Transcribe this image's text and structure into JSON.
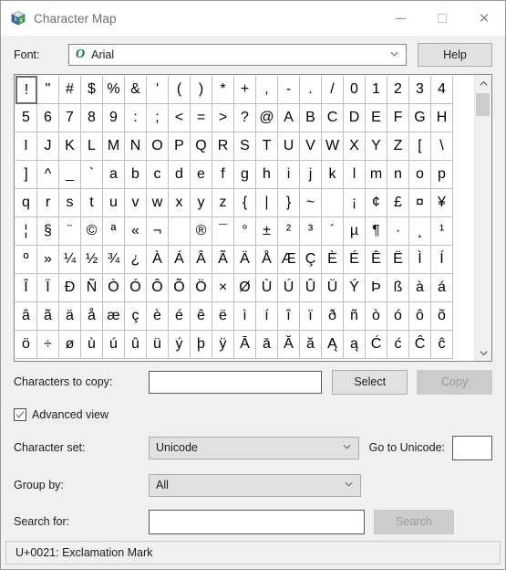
{
  "window": {
    "title": "Character Map",
    "icon": "character-map-icon",
    "controls": {
      "minimize": "minimize-icon",
      "maximize": "maximize-icon",
      "close": "close-icon"
    }
  },
  "font_row": {
    "label": "Font:",
    "font_icon": "O",
    "font_value": "Arial",
    "help_label": "Help"
  },
  "grid": {
    "columns": 20,
    "selected_index": 0,
    "characters": [
      "!",
      "\"",
      "#",
      "$",
      "%",
      "&",
      "'",
      "(",
      ")",
      "*",
      "+",
      ",",
      "-",
      ".",
      "/",
      "0",
      "1",
      "2",
      "3",
      "4",
      "5",
      "6",
      "7",
      "8",
      "9",
      ":",
      ";",
      "<",
      "=",
      ">",
      "?",
      "@",
      "A",
      "B",
      "C",
      "D",
      "E",
      "F",
      "G",
      "H",
      "I",
      "J",
      "K",
      "L",
      "M",
      "N",
      "O",
      "P",
      "Q",
      "R",
      "S",
      "T",
      "U",
      "V",
      "W",
      "X",
      "Y",
      "Z",
      "[",
      "\\",
      "]",
      "^",
      "_",
      "`",
      "a",
      "b",
      "c",
      "d",
      "e",
      "f",
      "g",
      "h",
      "i",
      "j",
      "k",
      "l",
      "m",
      "n",
      "o",
      "p",
      "q",
      "r",
      "s",
      "t",
      "u",
      "v",
      "w",
      "x",
      "y",
      "z",
      "{",
      "|",
      "}",
      "~",
      " ",
      "¡",
      "¢",
      "£",
      "¤",
      "¥",
      "¦",
      "§",
      "¨",
      "©",
      "ª",
      "«",
      "¬",
      "­",
      "®",
      "¯",
      "°",
      "±",
      "²",
      "³",
      "´",
      "µ",
      "¶",
      "·",
      "¸",
      "¹",
      "º",
      "»",
      "¼",
      "½",
      "¾",
      "¿",
      "À",
      "Á",
      "Â",
      "Ã",
      "Ä",
      "Å",
      "Æ",
      "Ç",
      "È",
      "É",
      "Ê",
      "Ë",
      "Ì",
      "Í",
      "Î",
      "Ï",
      "Ð",
      "Ñ",
      "Ò",
      "Ó",
      "Ô",
      "Õ",
      "Ö",
      "×",
      "Ø",
      "Ù",
      "Ú",
      "Û",
      "Ü",
      "Ý",
      "Þ",
      "ß",
      "à",
      "á",
      "â",
      "ã",
      "ä",
      "å",
      "æ",
      "ç",
      "è",
      "é",
      "ê",
      "ë",
      "ì",
      "í",
      "î",
      "ï",
      "ð",
      "ñ",
      "ò",
      "ó",
      "ô",
      "õ",
      "ö",
      "÷",
      "ø",
      "ù",
      "ú",
      "û",
      "ü",
      "ý",
      "þ",
      "ÿ",
      "Ā",
      "ā",
      "Ă",
      "ă",
      "Ą",
      "ą",
      "Ć",
      "ć",
      "Ĉ",
      "ĉ"
    ],
    "scrollbar": {
      "up_icon": "chevron-up-icon",
      "down_icon": "chevron-down-icon"
    }
  },
  "copy_row": {
    "label": "Characters to copy:",
    "value": "",
    "placeholder": "",
    "select_label": "Select",
    "copy_label": "Copy",
    "copy_disabled": true
  },
  "advanced_view": {
    "label": "Advanced view",
    "checked": true
  },
  "character_set": {
    "label": "Character set:",
    "value": "Unicode"
  },
  "go_to_unicode": {
    "label": "Go to Unicode:",
    "value": "",
    "placeholder": ""
  },
  "group_by": {
    "label": "Group by:",
    "value": "All"
  },
  "search": {
    "label": "Search for:",
    "value": "",
    "placeholder": "",
    "button_label": "Search",
    "button_disabled": true
  },
  "status_bar": {
    "text": "U+0021: Exclamation Mark"
  },
  "colors": {
    "window_bg": "#f0f0f0",
    "titlebar_bg": "#ffffff",
    "title_text": "#6e6e6e",
    "field_bg": "#ffffff",
    "button_bg": "#e1e1e1",
    "button_disabled_bg": "#cccccc",
    "border": "#848484",
    "grid_line": "#bfbfbf",
    "selection_border": "#6d6d6d",
    "tt_icon": "#0b6b5e"
  }
}
